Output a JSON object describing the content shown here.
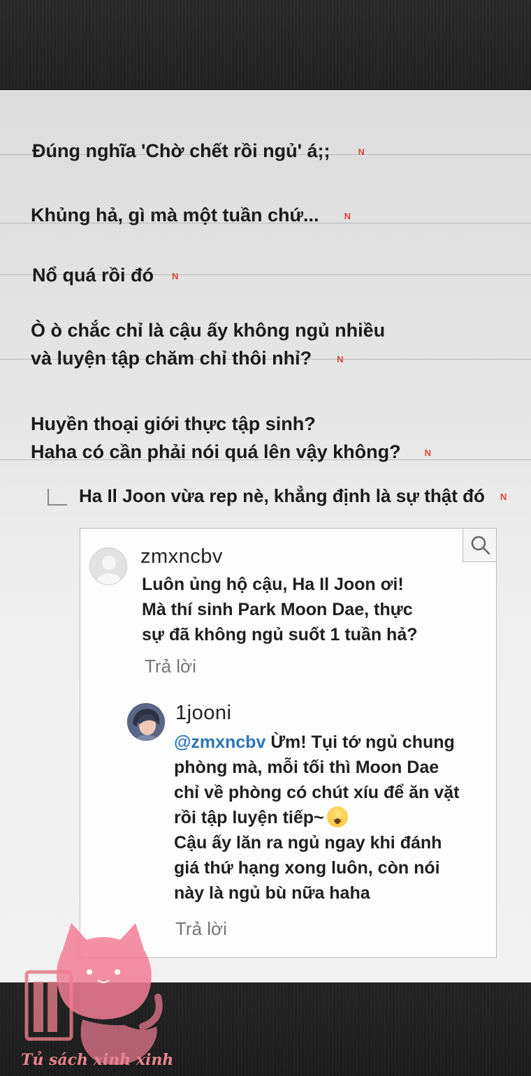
{
  "comments": [
    {
      "text": "Đúng nghĩa 'Chờ chết rồi ngủ' á;;",
      "badge": "N"
    },
    {
      "text": "Khủng hả, gì mà một tuần chứ...",
      "badge": "N"
    },
    {
      "text": "Nổ quá rồi đó",
      "badge": "N"
    },
    {
      "text": "Ò ò chắc chỉ là cậu ấy không ngủ nhiều\nvà luyện tập chăm chỉ thôi nhỉ?",
      "badge": "N"
    },
    {
      "text": "Huyền thoại giới thực tập sinh?\nHaha có cần phải nói quá lên vậy không?",
      "badge": "N"
    }
  ],
  "reply": {
    "text": "Ha Il Joon vừa rep nè, khẳng định là sự thật đó",
    "badge": "N"
  },
  "card": {
    "post": {
      "username": "zmxncbv",
      "text": "Luôn ủng hộ cậu, Ha Il Joon ơi!\nMà thí sinh Park Moon Dae, thực\nsự đã không ngủ suốt 1 tuần hả?",
      "reply_label": "Trả lời"
    },
    "answer": {
      "username": "1jooni",
      "mention": "@zmxncbv",
      "text_part1": " Ừm! Tụi tớ ngủ chung\nphòng mà, mỗi tối thì Moon Dae\nchỉ về phòng có chút xíu để ăn vặt\nrồi tập luyện tiếp~",
      "text_part2": "Cậu ấy lăn ra ngủ ngay khi đánh\ngiá thứ hạng xong luôn, còn nói\nnày là ngủ bù nữa haha",
      "emoji": "dizzy-face",
      "reply_label": "Trả lời"
    },
    "search_icon": "search-icon"
  },
  "watermark": {
    "text": "Tủ sách xinh xinh",
    "icon": "cat-book-logo"
  },
  "colors": {
    "badge": "#d9483b",
    "mention": "#2a76b8",
    "watermark": "#e8848e"
  }
}
